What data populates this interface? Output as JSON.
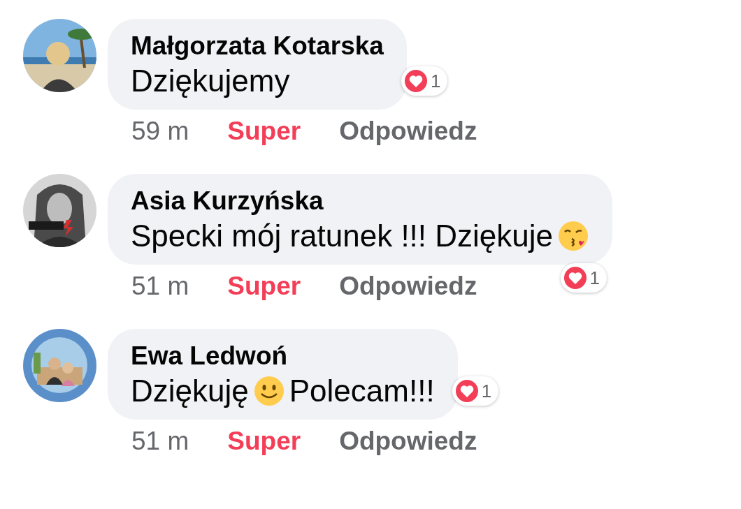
{
  "comments": [
    {
      "author": "Małgorzata Kotarska",
      "avatar": {
        "kind": "picture"
      },
      "text": [
        {
          "kind": "text",
          "text": "Dziękujemy"
        }
      ],
      "reaction": {
        "kind": "love",
        "count": "1"
      },
      "time": "59 m",
      "like": {
        "label": "Super",
        "selected": true
      },
      "reply": "Odpowiedz"
    },
    {
      "author": "Asia Kurzyńska",
      "avatar": {
        "kind": "picture"
      },
      "text": [
        {
          "kind": "text",
          "text": "Specki mój ratunek !!! Dziękuje"
        },
        {
          "kind": "kiss"
        }
      ],
      "reaction": {
        "kind": "love",
        "count": "1"
      },
      "time": "51 m",
      "like": {
        "label": "Super",
        "selected": true
      },
      "reply": "Odpowiedz"
    },
    {
      "author": "Ewa Ledwoń",
      "avatar": {
        "kind": "picture"
      },
      "text": [
        {
          "kind": "text",
          "text": "Dziękuję"
        },
        {
          "kind": "smile"
        },
        {
          "kind": "text",
          "text": "Polecam!!!"
        }
      ],
      "reaction": {
        "kind": "love",
        "count": "1"
      },
      "time": "51 m",
      "like": {
        "label": "Super",
        "selected": true
      },
      "reply": "Odpowiedz"
    }
  ]
}
